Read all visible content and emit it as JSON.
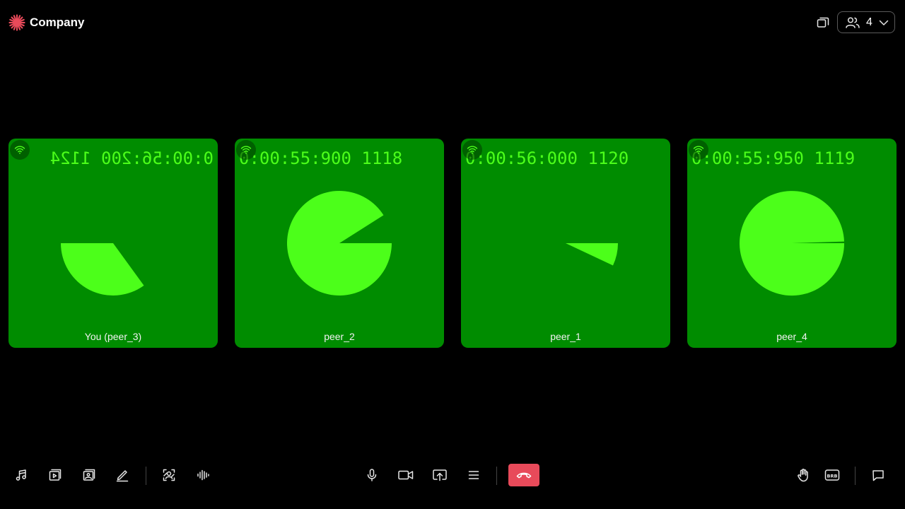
{
  "app": {
    "brand_name": "Company",
    "brand_color": "#e84a5a"
  },
  "header": {
    "layout_icon": "layout-switch-icon",
    "participants_icon": "people-icon",
    "participants_count": "4"
  },
  "tiles": [
    {
      "peer_name": "You (peer_3)",
      "stats": "0:00:56:200 1124",
      "mirrored": true,
      "progress": 0.35,
      "network_icon": "wifi-icon"
    },
    {
      "peer_name": "peer_2",
      "stats": "0:00:55:900 1118",
      "mirrored": false,
      "progress": 0.91,
      "network_icon": "wifi-icon"
    },
    {
      "peer_name": "peer_1",
      "stats": "0:00:56:000 1120",
      "mirrored": false,
      "progress": 0.07,
      "network_icon": "wifi-icon"
    },
    {
      "peer_name": "peer_4",
      "stats": "0:00:55:950 1119",
      "mirrored": false,
      "progress": 0.995,
      "network_icon": "wifi-icon"
    }
  ],
  "colors": {
    "tile_background": "#008c00",
    "overlay_green": "#4cff1a",
    "end_call": "#e84a5a"
  },
  "toolbar": {
    "left": [
      "music-icon",
      "play-video-icon",
      "media-gallery-icon",
      "whiteboard-pen-icon",
      "background-effects-icon",
      "noise-suppression-icon"
    ],
    "center": [
      "microphone-icon",
      "camera-icon",
      "screen-share-icon",
      "more-menu-icon",
      "end-call-icon"
    ],
    "right": [
      "raise-hand-icon",
      "brb-icon",
      "chat-icon"
    ],
    "brb_label": "BRB"
  }
}
